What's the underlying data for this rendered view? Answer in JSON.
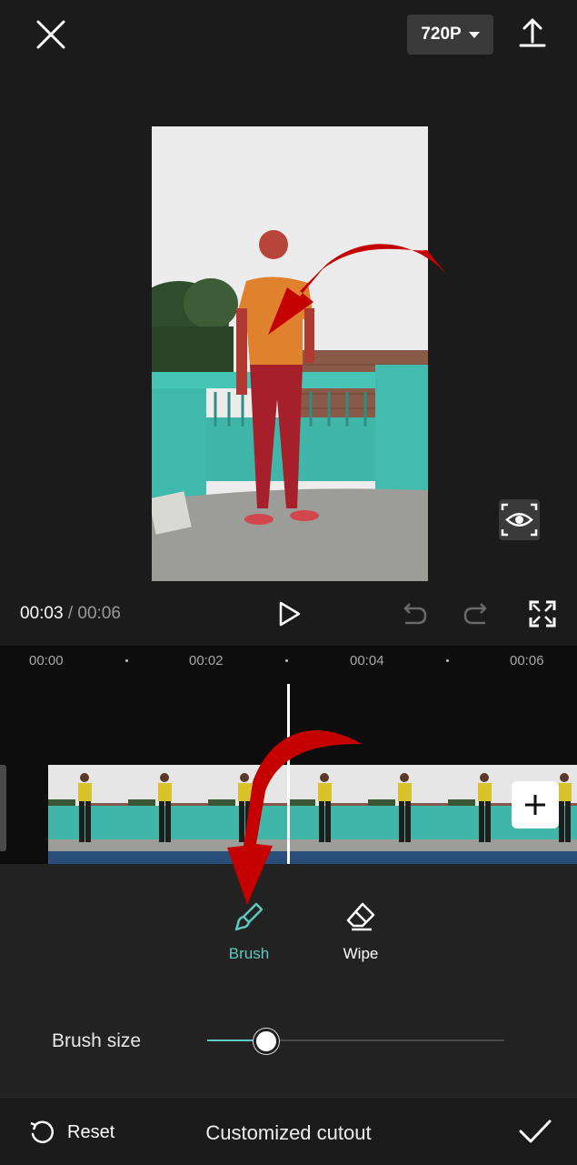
{
  "header": {
    "resolution_label": "720P"
  },
  "player": {
    "current_time": "00:03",
    "separator": "/",
    "total_time": "00:06"
  },
  "timeline": {
    "ruler": [
      "00:00",
      "00:02",
      "00:04",
      "00:06"
    ]
  },
  "tools": {
    "brush_label": "Brush",
    "wipe_label": "Wipe",
    "selected": "Brush"
  },
  "brush_size": {
    "label": "Brush size",
    "value_fraction": 0.2
  },
  "footer": {
    "reset_label": "Reset",
    "title": "Customized cutout"
  },
  "colors": {
    "accent": "#5fc8be",
    "background": "#1b1b1b",
    "annotation_red": "#c40000"
  },
  "icons": [
    "close-icon",
    "caret-down-icon",
    "export-icon",
    "eye-icon",
    "play-icon",
    "undo-icon",
    "redo-icon",
    "fullscreen-icon",
    "plus-icon",
    "brush-icon",
    "eraser-icon",
    "reset-icon",
    "check-icon"
  ]
}
